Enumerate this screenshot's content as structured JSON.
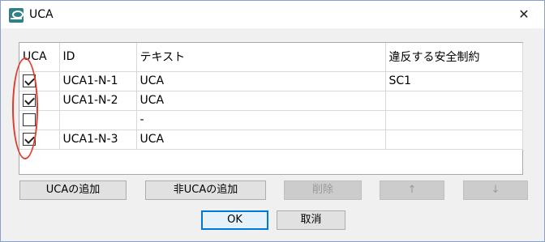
{
  "window": {
    "title": "UCA",
    "close_glyph": "✕",
    "icon": "stpa-app-icon"
  },
  "table": {
    "headers": [
      "UCA",
      "ID",
      "テキスト",
      "違反する安全制約"
    ],
    "rows": [
      {
        "checked": true,
        "id": "UCA1-N-1",
        "text": "UCA",
        "constraint": "SC1"
      },
      {
        "checked": true,
        "id": "UCA1-N-2",
        "text": "UCA",
        "constraint": ""
      },
      {
        "checked": false,
        "id": "",
        "text": "-",
        "constraint": ""
      },
      {
        "checked": true,
        "id": "UCA1-N-3",
        "text": "UCA",
        "constraint": ""
      }
    ]
  },
  "buttons": {
    "add_uca": "UCAの追加",
    "add_non_uca": "非UCAの追加",
    "delete": "削除",
    "up": "↑",
    "down": "↓",
    "ok": "OK",
    "cancel": "取消"
  },
  "colors": {
    "annotation": "#e03a2e",
    "default_button_border": "#0078d7"
  }
}
